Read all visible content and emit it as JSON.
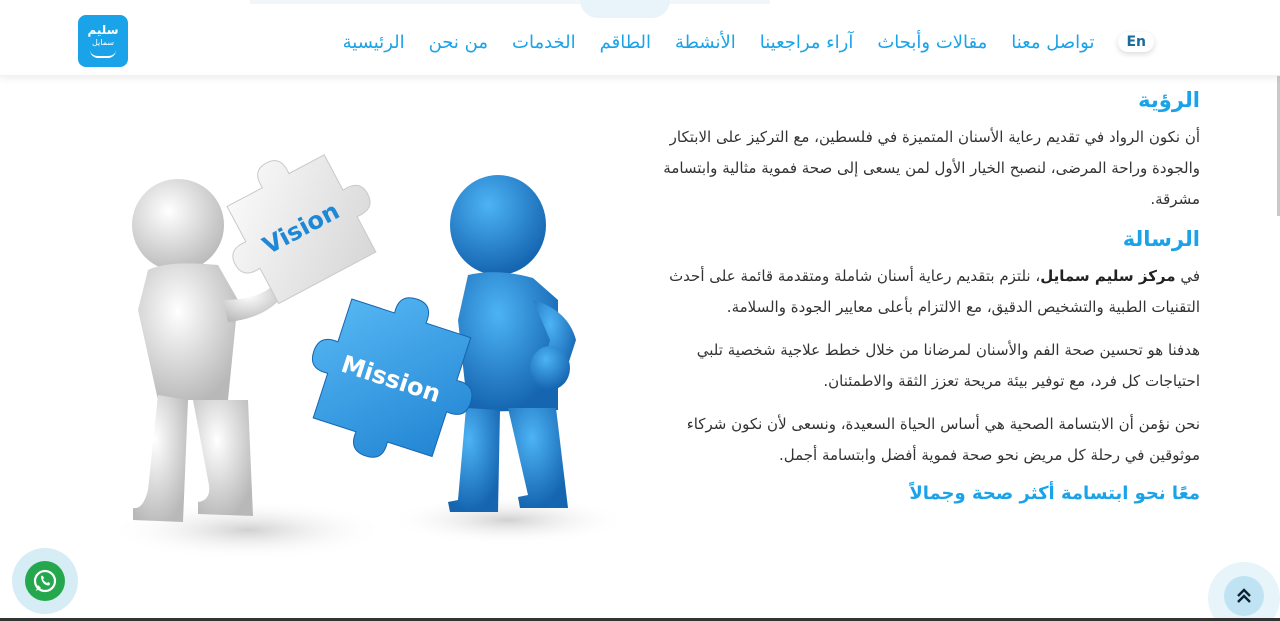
{
  "header": {
    "logo": {
      "line1": "سليم",
      "line2": "سمايل"
    },
    "lang_toggle": "En",
    "nav_items": [
      {
        "label": "الرئيسية"
      },
      {
        "label": "من نحن"
      },
      {
        "label": "الخدمات"
      },
      {
        "label": "الطاقم"
      },
      {
        "label": "الأنشطة"
      },
      {
        "label": "آراء مراجعينا"
      },
      {
        "label": "مقالات وأبحاث"
      },
      {
        "label": "تواصل معنا"
      }
    ]
  },
  "vision": {
    "title": "الرؤية",
    "text": "أن نكون الرواد في تقديم رعاية الأسنان المتميزة في فلسطين، مع التركيز على الابتكار والجودة وراحة المرضى، لنصبح الخيار الأول لمن يسعى إلى صحة فموية مثالية وابتسامة مشرقة."
  },
  "mission": {
    "title": "الرسالة",
    "intro_prefix": "في ",
    "center_name": "مركز سليم سمايل",
    "intro_rest": "، نلتزم بتقديم رعاية أسنان شاملة ومتقدمة قائمة على أحدث التقنيات الطبية والتشخيص الدقيق، مع الالتزام بأعلى معايير الجودة والسلامة.",
    "para2": "هدفنا هو تحسين صحة الفم والأسنان لمرضانا من خلال خطط علاجية شخصية تلبي احتياجات كل فرد، مع توفير بيئة مريحة تعزز الثقة والاطمئنان.",
    "para3": "نحن نؤمن أن الابتسامة الصحية هي أساس الحياة السعيدة، ونسعى لأن نكون شركاء موثوقين في رحلة كل مريض نحو صحة فموية أفضل وابتسامة أجمل."
  },
  "slogan": "معًا نحو ابتسامة أكثر صحة وجمالاً",
  "illustration": {
    "piece_left": "Vision",
    "piece_right": "Mission"
  },
  "colors": {
    "accent": "#1aa3e8",
    "figure_blue": "#1e88d6",
    "figure_grey": "#e6e6e6",
    "whatsapp": "#25a84d"
  },
  "icons": {
    "whatsapp": "whatsapp-icon",
    "scroll_top": "double-chevron-up-icon"
  }
}
